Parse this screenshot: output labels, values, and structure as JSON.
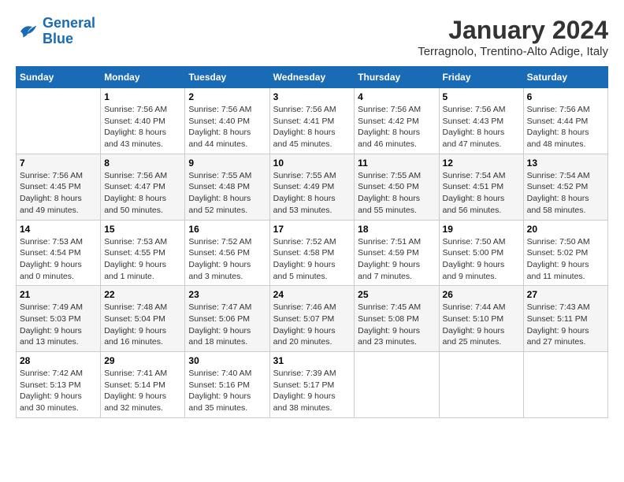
{
  "logo": {
    "line1": "General",
    "line2": "Blue"
  },
  "title": "January 2024",
  "location": "Terragnolo, Trentino-Alto Adige, Italy",
  "days_of_week": [
    "Sunday",
    "Monday",
    "Tuesday",
    "Wednesday",
    "Thursday",
    "Friday",
    "Saturday"
  ],
  "weeks": [
    [
      {
        "day": "",
        "info": ""
      },
      {
        "day": "1",
        "info": "Sunrise: 7:56 AM\nSunset: 4:40 PM\nDaylight: 8 hours\nand 43 minutes."
      },
      {
        "day": "2",
        "info": "Sunrise: 7:56 AM\nSunset: 4:40 PM\nDaylight: 8 hours\nand 44 minutes."
      },
      {
        "day": "3",
        "info": "Sunrise: 7:56 AM\nSunset: 4:41 PM\nDaylight: 8 hours\nand 45 minutes."
      },
      {
        "day": "4",
        "info": "Sunrise: 7:56 AM\nSunset: 4:42 PM\nDaylight: 8 hours\nand 46 minutes."
      },
      {
        "day": "5",
        "info": "Sunrise: 7:56 AM\nSunset: 4:43 PM\nDaylight: 8 hours\nand 47 minutes."
      },
      {
        "day": "6",
        "info": "Sunrise: 7:56 AM\nSunset: 4:44 PM\nDaylight: 8 hours\nand 48 minutes."
      }
    ],
    [
      {
        "day": "7",
        "info": "Sunrise: 7:56 AM\nSunset: 4:45 PM\nDaylight: 8 hours\nand 49 minutes."
      },
      {
        "day": "8",
        "info": "Sunrise: 7:56 AM\nSunset: 4:47 PM\nDaylight: 8 hours\nand 50 minutes."
      },
      {
        "day": "9",
        "info": "Sunrise: 7:55 AM\nSunset: 4:48 PM\nDaylight: 8 hours\nand 52 minutes."
      },
      {
        "day": "10",
        "info": "Sunrise: 7:55 AM\nSunset: 4:49 PM\nDaylight: 8 hours\nand 53 minutes."
      },
      {
        "day": "11",
        "info": "Sunrise: 7:55 AM\nSunset: 4:50 PM\nDaylight: 8 hours\nand 55 minutes."
      },
      {
        "day": "12",
        "info": "Sunrise: 7:54 AM\nSunset: 4:51 PM\nDaylight: 8 hours\nand 56 minutes."
      },
      {
        "day": "13",
        "info": "Sunrise: 7:54 AM\nSunset: 4:52 PM\nDaylight: 8 hours\nand 58 minutes."
      }
    ],
    [
      {
        "day": "14",
        "info": "Sunrise: 7:53 AM\nSunset: 4:54 PM\nDaylight: 9 hours\nand 0 minutes."
      },
      {
        "day": "15",
        "info": "Sunrise: 7:53 AM\nSunset: 4:55 PM\nDaylight: 9 hours\nand 1 minute."
      },
      {
        "day": "16",
        "info": "Sunrise: 7:52 AM\nSunset: 4:56 PM\nDaylight: 9 hours\nand 3 minutes."
      },
      {
        "day": "17",
        "info": "Sunrise: 7:52 AM\nSunset: 4:58 PM\nDaylight: 9 hours\nand 5 minutes."
      },
      {
        "day": "18",
        "info": "Sunrise: 7:51 AM\nSunset: 4:59 PM\nDaylight: 9 hours\nand 7 minutes."
      },
      {
        "day": "19",
        "info": "Sunrise: 7:50 AM\nSunset: 5:00 PM\nDaylight: 9 hours\nand 9 minutes."
      },
      {
        "day": "20",
        "info": "Sunrise: 7:50 AM\nSunset: 5:02 PM\nDaylight: 9 hours\nand 11 minutes."
      }
    ],
    [
      {
        "day": "21",
        "info": "Sunrise: 7:49 AM\nSunset: 5:03 PM\nDaylight: 9 hours\nand 13 minutes."
      },
      {
        "day": "22",
        "info": "Sunrise: 7:48 AM\nSunset: 5:04 PM\nDaylight: 9 hours\nand 16 minutes."
      },
      {
        "day": "23",
        "info": "Sunrise: 7:47 AM\nSunset: 5:06 PM\nDaylight: 9 hours\nand 18 minutes."
      },
      {
        "day": "24",
        "info": "Sunrise: 7:46 AM\nSunset: 5:07 PM\nDaylight: 9 hours\nand 20 minutes."
      },
      {
        "day": "25",
        "info": "Sunrise: 7:45 AM\nSunset: 5:08 PM\nDaylight: 9 hours\nand 23 minutes."
      },
      {
        "day": "26",
        "info": "Sunrise: 7:44 AM\nSunset: 5:10 PM\nDaylight: 9 hours\nand 25 minutes."
      },
      {
        "day": "27",
        "info": "Sunrise: 7:43 AM\nSunset: 5:11 PM\nDaylight: 9 hours\nand 27 minutes."
      }
    ],
    [
      {
        "day": "28",
        "info": "Sunrise: 7:42 AM\nSunset: 5:13 PM\nDaylight: 9 hours\nand 30 minutes."
      },
      {
        "day": "29",
        "info": "Sunrise: 7:41 AM\nSunset: 5:14 PM\nDaylight: 9 hours\nand 32 minutes."
      },
      {
        "day": "30",
        "info": "Sunrise: 7:40 AM\nSunset: 5:16 PM\nDaylight: 9 hours\nand 35 minutes."
      },
      {
        "day": "31",
        "info": "Sunrise: 7:39 AM\nSunset: 5:17 PM\nDaylight: 9 hours\nand 38 minutes."
      },
      {
        "day": "",
        "info": ""
      },
      {
        "day": "",
        "info": ""
      },
      {
        "day": "",
        "info": ""
      }
    ]
  ]
}
